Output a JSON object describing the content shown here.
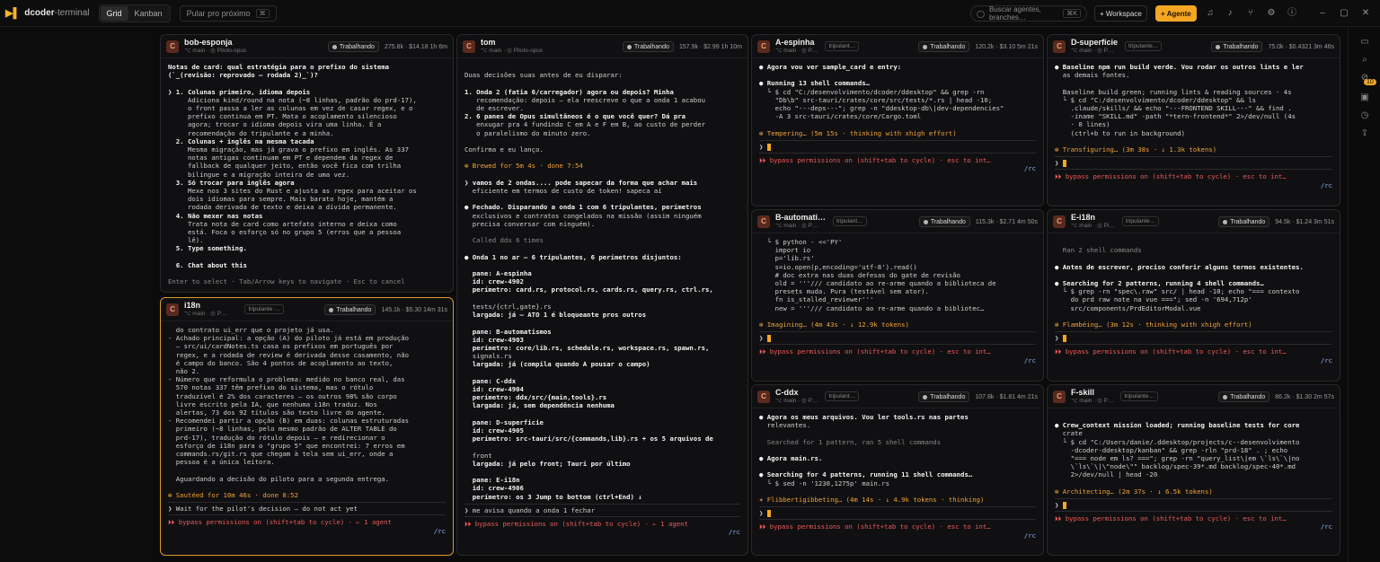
{
  "app": {
    "logo_mark": "▶▌",
    "name": "dcoder",
    "name_suffix": "-terminal"
  },
  "topbar": {
    "views": [
      "Grid",
      "Kanban"
    ],
    "skip_label": "Pular pro próximo",
    "skip_key": "⌘",
    "search_placeholder": "Buscar agentes, branches…",
    "search_key": "⌘K",
    "workspace_label": "+ Workspace",
    "agent_label": "+ Agente"
  },
  "rail": {
    "badge": "10"
  },
  "panels": [
    {
      "id": "bob",
      "avatar": "C",
      "name": "bob-esponja",
      "branch": "⌥ main · ◎ Piloto-opus",
      "status": "Trabalhando",
      "stats": "275.8k · $14.18  1h 6m",
      "lines": [
        "Notas de card: qual estratégia para o prefixo do sistema",
        "(`_(revisão: reprovado — rodada 2)_`)?",
        " ",
        "❯ 1. Colunas primeiro, idioma depois",
        "     Adiciona kind/round na nota (~8 linhas, padrão do prd-17),",
        "     o front passa a ler as colunas em vez de casar regex, e o",
        "     prefixo continua em PT. Mata o acoplamento silencioso",
        "     agora; trocar o idioma depois vira uma linha. É a",
        "     recomendação do tripulante e a minha.",
        "  2. Colunas + inglês na mesma tacada",
        "     Mesma migração, mas já grava o prefixo em inglês. As 337",
        "     notas antigas continuam em PT e dependem da regex de",
        "     fallback de qualquer jeito, então você fica com trilha",
        "     bilíngue e a migração inteira de uma vez.",
        "  3. Só trocar para inglês agora",
        "     Mexe nos 3 sites do Rust e ajusta as regex para aceitar os",
        "     dois idiomas para sempre. Mais barato hoje, mantém a",
        "     rodada derivada de texto e deixa a dívida permanente.",
        "  4. Não mexer nas notas",
        "     Trata nota de card como artefato interno e deixa como",
        "     está. Foca o esforço só no grupo 5 (erros que a pessoa",
        "     lê).",
        "  5. Type something.",
        " ",
        "  6. Chat about this",
        " ",
        "Enter to select · Tab/Arrow keys to navigate · Esc to cancel"
      ]
    },
    {
      "id": "i18n",
      "avatar": "C",
      "name": "i18n",
      "branch": "⌥ main · ◎ P…",
      "tag": "tripulante …",
      "status": "Trabalhando",
      "stats": "145.1k · $5.30  14m 31s",
      "lines": [
        "  do contrato ui_err que o projeto já usa.",
        "- Achado principal: a opção (A) do piloto já está em produção",
        "  — src/ui/cardNotes.ts casa os prefixos em português por",
        "  regex, e a rodada de review é derivada desse casamento, não",
        "  é campo do banco. São 4 pontos de acoplamento ao texto,",
        "  não 2.",
        "- Número que reformula o problema: medido no banco real, das",
        "  570 notas 337 têm prefixo do sistema, mas o rótulo",
        "  traduzível é 2% dos caracteres — os outros 98% são corpo",
        "  livre escrito pela IA, que nenhuma i18n traduz. Nos",
        "  alertas, 73 dos 92 títulos são texto livre do agente.",
        "- Recomendei partir a opção (B) em duas: colunas estruturadas",
        "  primeiro (~8 linhas, pelo mesmo padrão de ALTER TABLE do",
        "  prd-17), tradução do rótulo depois — e redirecionar o",
        "  esforço de i18n para o \"grupo 5\" que encontrei: 7 erros em",
        "  commands.rs/git.rs que chegam à tela sem ui_err, onde a",
        "  pessoa é a única leitora.",
        " ",
        "  Aguardando a decisão do piloto para a segunda entrega.",
        " ",
        "✻ Sautéed for 10m 46s · done 8:52"
      ],
      "input": "❯ Wait for the pilot's decision — do not act yet",
      "footer": "⏵⏵ bypass permissions on (shift+tab to cycle) · ← 1 agent",
      "footer2": "/rc"
    },
    {
      "id": "tom",
      "avatar": "C",
      "name": "tom",
      "branch": "⌥ main · ◎ Piloto-opus",
      "status": "Trabalhando",
      "stats": "157.9k · $2.99  1h 10m",
      "lines": [
        " ",
        "Duas decisões suas antes de eu disparar:",
        " ",
        "1. Onda 2 (fatia 6/carregador) agora ou depois? Minha",
        "   recomendação: depois — ela reescreve o que a onda 1 acabou",
        "   de escrever.",
        "2. 6 panes de Opus simultâneos é o que você quer? Dá pra",
        "   enxugar pra 4 fundindo C em A e F em B, ao custo de perder",
        "   o paralelismo do minuto zero.",
        " ",
        "Confirma e eu lanço.",
        " ",
        "✻ Brewed for 5m 4s · done 7:54",
        " ",
        "❯ vamos de 2 ondas.... pode sapecar da forma que achar mais",
        "  eficiente em termos de custo de token! sapeca aí",
        " ",
        "● Fechado. Disparando a onda 1 com 6 tripulantes, perímetros",
        "  exclusivos e contratos congelados na missão (assim ninguém",
        "  precisa conversar com ninguém).",
        " ",
        "  Called ddx 6 times",
        " ",
        "● Onda 1 no ar — 6 tripulantes, 6 perímetros disjuntos:",
        " ",
        "  pane: A-espinha",
        "  id: crew-4902",
        "  perímetro: card.rs, protocol.rs, cards.rs, query.rs, ctrl.rs,",
        " ",
        "  tests/{ctrl,gate}.rs",
        "  largada: já — ATO 1 é bloqueante pros outros",
        " ",
        "  pane: B-automatismos",
        "  id: crew-4903",
        "  perímetro: core/lib.rs, schedule.rs, workspace.rs, spawn.rs,",
        "  signals.rs",
        "  largada: já (compila quando A pousar o campo)",
        " ",
        "  pane: C-ddx",
        "  id: crew-4904",
        "  perímetro: ddx/src/{main,tools}.rs",
        "  largada: já, sem dependência nenhuma",
        " ",
        "  pane: D-superficie",
        "  id: crew-4905",
        "  perímetro: src-tauri/src/{commands,lib}.rs + os 5 arquivos de",
        " ",
        "  front",
        "  largada: já pelo front; Tauri por último",
        " ",
        "  pane: E-i18n",
        "  id: crew-4906",
        "  perímetro: os 3 Jump to bottom (ctrl+End) ↓"
      ],
      "input": "❯ me avisa quando a onda 1 fechar",
      "footer": "⏵⏵ bypass permissions on (shift+tab to cycle) · ← 1 agent",
      "footer2": "/rc"
    },
    {
      "id": "aesp",
      "avatar": "C",
      "name": "A-espinha",
      "branch": "⌥ main · ◎ P…",
      "tag": "tripulant…",
      "status": "Trabalhando",
      "stats": "120.2k · $3.10  5m 21s",
      "lines": [
        "● Agora vou ver sample_card e entry:",
        " ",
        "● Running 13 shell commands…",
        "  └ $ cd \"C:/desenvolvimento/dcoder/ddesktop\" && grep -rn",
        "    \"Db\\b\" src-tauri/crates/core/src/tests/*.rs | head -10;",
        "    echo \"---deps---\"; grep -n \"ddesktop-db\\|dev-dependencies\"",
        "    -A 3 src-tauri/crates/core/Cargo.toml",
        " ",
        "✻ Tempering… (5m 15s · thinking with xhigh effort)"
      ],
      "footer": "⏵⏵ bypass permissions on (shift+tab to cycle) · esc to int…",
      "footer2": "/rc"
    },
    {
      "id": "bauto",
      "avatar": "C",
      "name": "B-automati…",
      "branch": "⌥ main · ◎ P…",
      "tag": "tripulant…",
      "status": "Trabalhando",
      "stats": "115.3k · $2.71  4m 50s",
      "lines": [
        "  └ $ python - <<'PY'",
        "    import io",
        "    p='lib.rs'",
        "    s=io.open(p,encoding='utf-8').read()",
        "    # doc extra nas duas defesas do gate de revisão",
        "    old = '''/// candidato ao re-arme quando a biblioteca de",
        "    presets muda. Pura (testável sem ator).",
        "    fn is_stalled_reviewer'''",
        "    new = '''/// candidato ao re-arme quando a bibliotec…",
        " ",
        "✻ Imagining… (4m 43s · ↓ 12.9k tokens)"
      ],
      "footer": "⏵⏵ bypass permissions on (shift+tab to cycle) · esc to int…",
      "footer2": "/rc"
    },
    {
      "id": "cddx",
      "avatar": "C",
      "name": "C-ddx",
      "branch": "⌥ main · ◎ P…",
      "tag": "tripulant…",
      "status": "Trabalhando",
      "stats": "107.8k · $1.81  4m 21s",
      "lines": [
        "● Agora os meus arquivos. Vou ler tools.rs nas partes",
        "  relevantes.",
        " ",
        "  Searched for 1 pattern, ran 5 shell commands",
        " ",
        "● Agora main.rs.",
        " ",
        "● Searching for 4 patterns, running 11 shell commands…",
        "  └ $ sed -n '1230,1275p' main.rs",
        " ",
        "✶ Flibbertigibbeting… (4m 14s · ↓ 4.9k tokens · thinking)"
      ],
      "footer": "⏵⏵ bypass permissions on (shift+tab to cycle) · esc to int…",
      "footer2": "/rc"
    },
    {
      "id": "dsup",
      "avatar": "C",
      "name": "D-superficie",
      "branch": "⌥ main · ◎ P…",
      "tag": "tripulante…",
      "status": "Trabalhando",
      "stats": "75.0k · $0.4321  3m 46s",
      "lines": [
        "● Baseline npm run build verde. Vou rodar os outros lints e ler",
        "  as demais fontes.",
        " ",
        "  Baseline build green; running lints & reading sources · 4s",
        "  └ $ cd \"C:/desenvolvimento/dcoder/ddesktop\" && ls",
        "    .claude/skills/ && echo \"---FRONTEND SKILL---\" && find .",
        "    -iname \"SKILL.md\" -path \"*tern-frontend*\" 2>/dev/null (4s",
        "    · 0 lines)",
        "    (ctrl+b to run in background)",
        " ",
        "✻ Transfiguring… (3m 38s · ↓ 1.3k tokens)"
      ],
      "footer": "⏵⏵ bypass permissions on (shift+tab to cycle) · esc to int…",
      "footer2": "/rc"
    },
    {
      "id": "ei18n",
      "avatar": "C",
      "name": "E-i18n",
      "branch": "⌥ main · ◎ Pi…",
      "tag": "tripulante…",
      "status": "Trabalhando",
      "stats": "94.5k · $1.24  3m 51s",
      "lines": [
        " ",
        "  Ran 2 shell commands",
        " ",
        "● Antes de escrever, preciso conferir alguns termos existentes.",
        " ",
        "● Searching for 2 patterns, running 4 shell commands…",
        "  └ $ grep -rn \"spec\\.raw\" src/ | head -10; echo \"=== contexto",
        "    do prd raw note na vue ===\"; sed -n '694,712p'",
        "    src/components/PrdEditorModal.vue",
        " ",
        "✻ Flambéing… (3m 12s · thinking with xhigh effort)"
      ],
      "footer": "⏵⏵ bypass permissions on (shift+tab to cycle) · esc to int…",
      "footer2": "/rc"
    },
    {
      "id": "fskill",
      "avatar": "C",
      "name": "F-skill",
      "branch": "⌥ main · ◎ P…",
      "tag": "tripulante…",
      "status": "Trabalhando",
      "stats": "86.2k · $1.30  2m 57s",
      "lines": [
        " ",
        "● Crew_context mission loaded; running baseline tests for core",
        "  crate",
        "  └ $ cd \"C:/Users/danie/.ddesktop/projects/c--desenvolvimento",
        "    -dcoder-ddesktop/kanban\" && grep -rln \"prd-18\" . ; echo",
        "    \"=== node em ls? ===\"; grep -rn \"query_list\\|em \\`ls\\`\\|no",
        "    \\`ls\\`\\|\\\"node\\\"\" backlog/spec-39*.md backlog/spec-40*.md",
        "    2>/dev/null | head -20",
        " ",
        "✻ Architecting… (2m 37s · ↓ 6.5k tokens)"
      ],
      "footer": "⏵⏵ bypass permissions on (shift+tab to cycle) · esc to int…",
      "footer2": "/rc"
    }
  ]
}
